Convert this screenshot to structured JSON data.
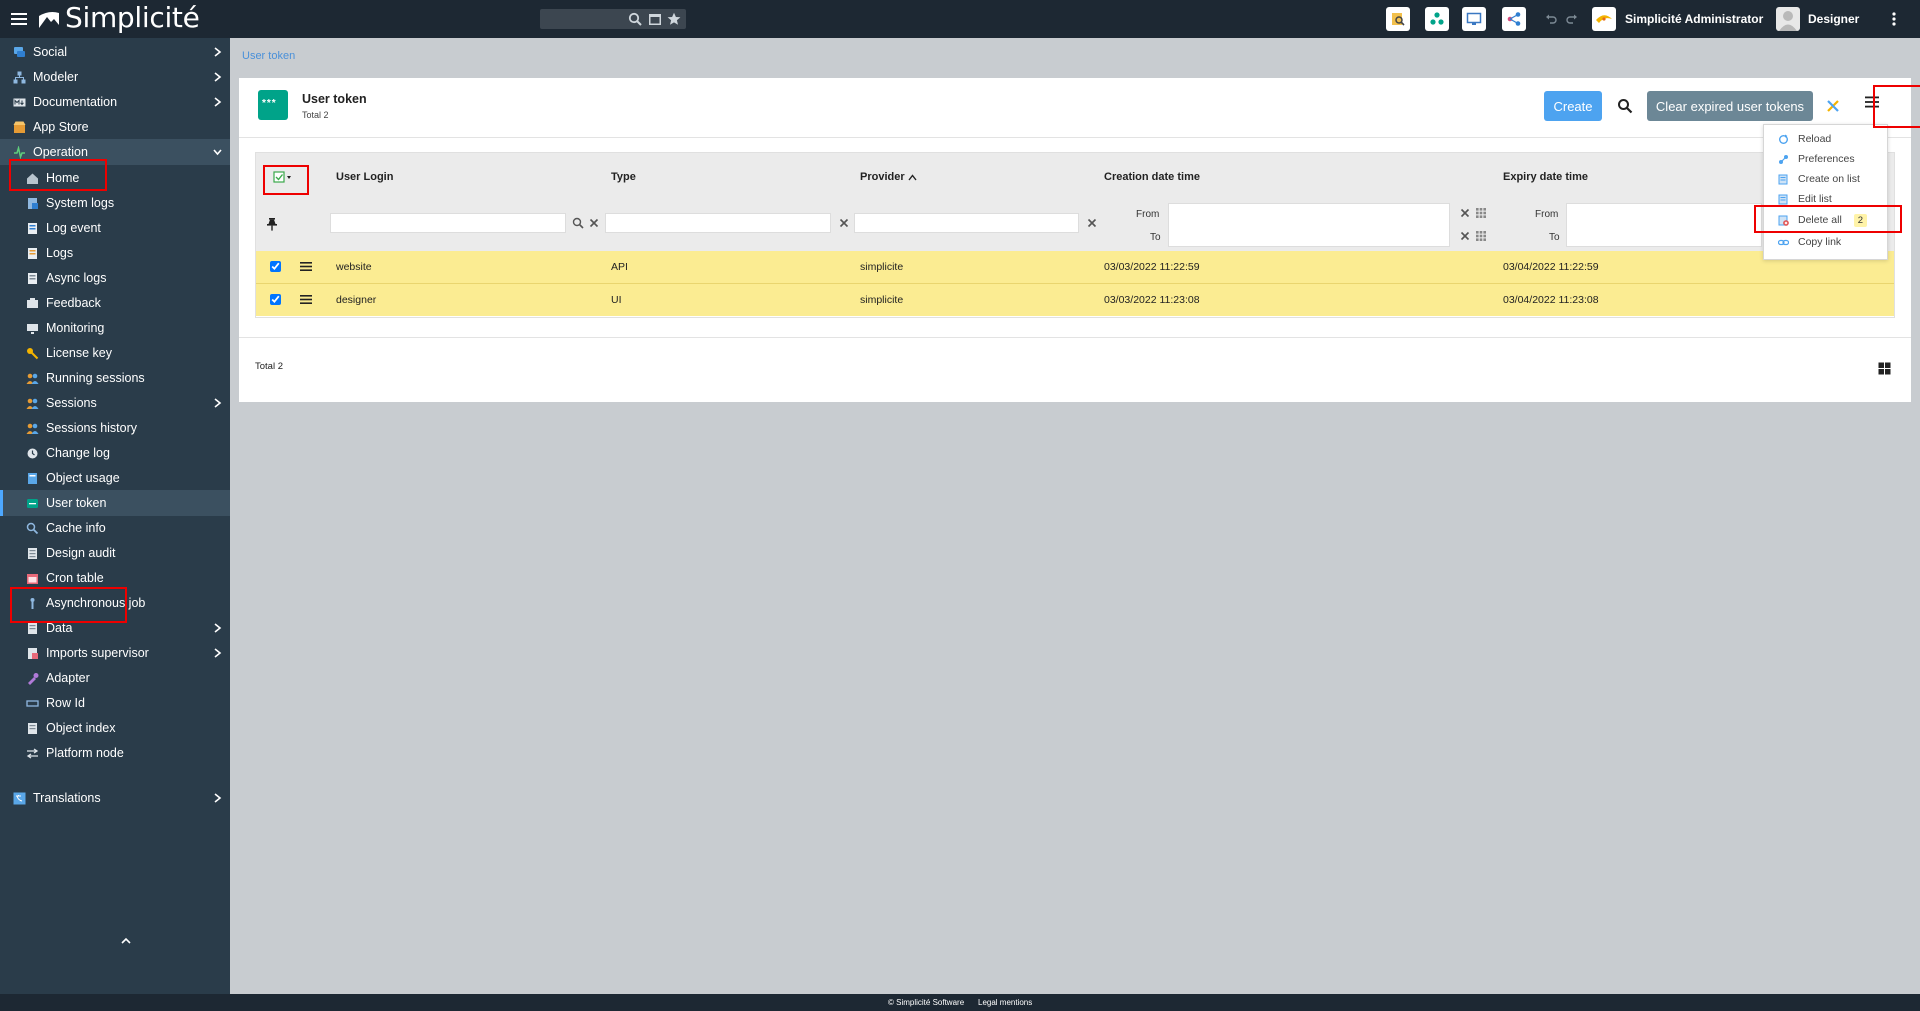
{
  "app": {
    "brand": "Simplicité",
    "user_role": "Simplicité Administrator",
    "user_name": "Designer"
  },
  "search": {
    "value": "",
    "placeholder": ""
  },
  "sidebar": {
    "groups": [
      {
        "label": "Social"
      },
      {
        "label": "Modeler"
      },
      {
        "label": "Documentation"
      },
      {
        "label": "App Store"
      },
      {
        "label": "Operation"
      }
    ],
    "operation_items": [
      {
        "label": "Home"
      },
      {
        "label": "System logs"
      },
      {
        "label": "Log event"
      },
      {
        "label": "Logs"
      },
      {
        "label": "Async logs"
      },
      {
        "label": "Feedback"
      },
      {
        "label": "Monitoring"
      },
      {
        "label": "License key"
      },
      {
        "label": "Running sessions"
      },
      {
        "label": "Sessions"
      },
      {
        "label": "Sessions history"
      },
      {
        "label": "Change log"
      },
      {
        "label": "Object usage"
      },
      {
        "label": "User token"
      },
      {
        "label": "Cache info"
      },
      {
        "label": "Design audit"
      },
      {
        "label": "Cron table"
      },
      {
        "label": "Asynchronous job"
      },
      {
        "label": "Data"
      },
      {
        "label": "Imports supervisor"
      },
      {
        "label": "Adapter"
      },
      {
        "label": "Row Id"
      },
      {
        "label": "Object index"
      },
      {
        "label": "Platform node"
      }
    ],
    "translations": {
      "label": "Translations"
    }
  },
  "breadcrumb": "User token",
  "object": {
    "icon_text": "***",
    "title": "User token",
    "total": "Total 2",
    "create_label": "Create",
    "clear_label": "Clear expired user tokens"
  },
  "grid": {
    "columns": [
      "User Login",
      "Type",
      "Provider",
      "Creation date time",
      "Expiry date time"
    ],
    "sort_column": "Provider",
    "sort_direction": "ascending",
    "range_from": "From",
    "range_to": "To",
    "rows": [
      {
        "login": "website",
        "type": "API",
        "provider": "simplicite",
        "created": "03/03/2022 11:22:59",
        "expiry": "03/04/2022 11:22:59",
        "checked": true
      },
      {
        "login": "designer",
        "type": "UI",
        "provider": "simplicite",
        "created": "03/03/2022 11:23:08",
        "expiry": "03/04/2022 11:23:08",
        "checked": true
      }
    ],
    "footer_total": "Total 2"
  },
  "action_menu": {
    "items": [
      {
        "label": "Reload"
      },
      {
        "label": "Preferences"
      },
      {
        "label": "Create on list"
      },
      {
        "label": "Edit list"
      },
      {
        "label": "Delete all",
        "badge": "2"
      },
      {
        "label": "Copy link"
      }
    ]
  },
  "footer": {
    "copyright": "© Simplicité Software",
    "legal": "Legal mentions"
  },
  "colors": {
    "topbar": "#1d2833",
    "sidebar": "#2a3c4a",
    "primary_button": "#4da3f0",
    "secondary_button": "#6c8796",
    "object_icon": "#00a389",
    "selected_row": "#fbec92",
    "highlight": "#e00000"
  }
}
